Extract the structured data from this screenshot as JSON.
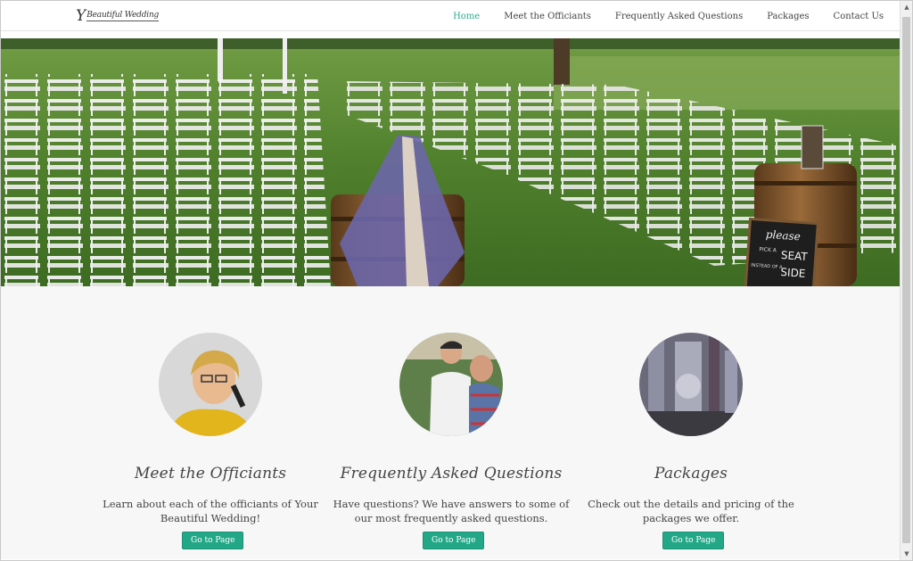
{
  "site": {
    "logo_mark": "Y",
    "logo_text": "Beautiful Wedding"
  },
  "nav": {
    "items": [
      {
        "label": "Home",
        "active": true
      },
      {
        "label": "Meet the Officiants",
        "active": false
      },
      {
        "label": "Frequently Asked Questions",
        "active": false
      },
      {
        "label": "Packages",
        "active": false
      },
      {
        "label": "Contact Us",
        "active": false
      }
    ]
  },
  "hero": {
    "sign_line1": "please",
    "sign_line2": "PICK A",
    "sign_line3": "SEAT",
    "sign_line4": "INSTEAD OF A",
    "sign_line5": "SIDE"
  },
  "features": [
    {
      "title": "Meet the Officiants",
      "text": "Learn about each of the officiants of Your Beautiful Wedding!",
      "button": "Go to Page",
      "image_icon": "officiant-portrait"
    },
    {
      "title": "Frequently Asked Questions",
      "text": "Have questions? We have answers to some of our most frequently asked questions.",
      "button": "Go to Page",
      "image_icon": "officiants-at-ceremony"
    },
    {
      "title": "Packages",
      "text": "Check out the details and pricing of the packages we offer.",
      "button": "Go to Page",
      "image_icon": "wedding-decor"
    }
  ],
  "colors": {
    "accent": "#2bae8e",
    "button": "#23a887",
    "content_bg": "#f7f7f7"
  }
}
